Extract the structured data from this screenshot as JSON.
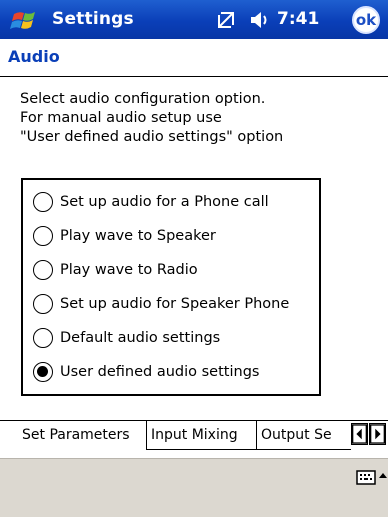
{
  "titlebar": {
    "app_title": "Settings",
    "time": "7:41",
    "ok_label": "ok",
    "icons": [
      "start-logo-icon",
      "connectivity-icon",
      "volume-icon"
    ]
  },
  "page": {
    "title": "Audio",
    "instructions": [
      "Select audio configuration option.",
      "For manual audio setup use",
      "\"User defined audio settings\" option"
    ]
  },
  "options": [
    {
      "label": "Set up audio for a Phone call",
      "checked": false
    },
    {
      "label": "Play wave to Speaker",
      "checked": false
    },
    {
      "label": "Play wave to Radio",
      "checked": false
    },
    {
      "label": "Set up audio for Speaker Phone",
      "checked": false
    },
    {
      "label": "Default audio settings",
      "checked": false
    },
    {
      "label": "User defined audio settings",
      "checked": true
    }
  ],
  "tabs": [
    {
      "label": "Set Parameters",
      "active": true
    },
    {
      "label": "Input Mixing",
      "active": false
    },
    {
      "label": "Output Se",
      "active": false
    }
  ],
  "menubar": {
    "icons": [
      "keyboard-icon",
      "sip-arrow-icon"
    ]
  },
  "colors": {
    "titlebar": "#0a3fb8",
    "accent": "#0a3fb8",
    "menubar": "#dcd8d0"
  }
}
